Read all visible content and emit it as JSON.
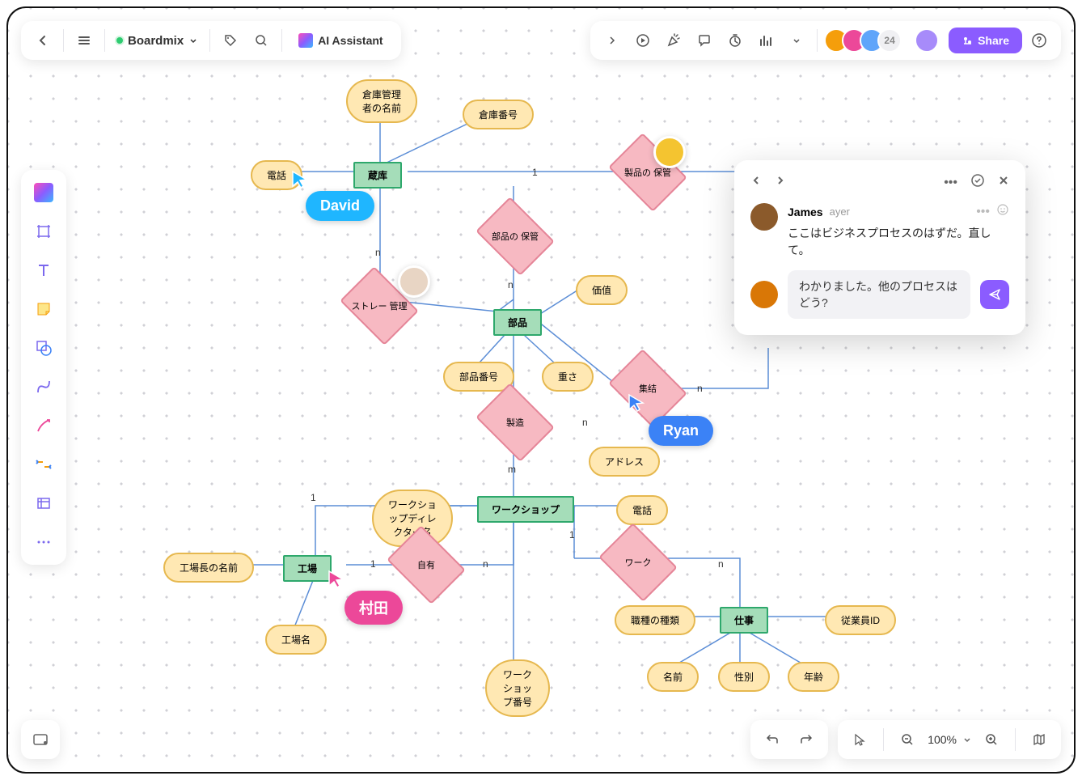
{
  "topbar": {
    "title": "Boardmix",
    "ai_label": "AI Assistant",
    "share_label": "Share",
    "avatar_count": "24"
  },
  "zoom": {
    "value": "100%"
  },
  "cursors": {
    "david": "David",
    "ryan": "Ryan",
    "murata": "村田"
  },
  "comments": {
    "author1": "James",
    "time1": "ayer",
    "text1": "ここはビジネスプロセスのはずだ。直して。",
    "reply_text": "わかりました。他のプロセスはどう?"
  },
  "nodes": {
    "warehouse_mgr_name": "倉庫管理者の名前",
    "warehouse_no": "倉庫番号",
    "phone1": "電話",
    "warehouse": "蔵库",
    "product_storage": "製品の\n保管",
    "parts_storage": "部品の\n保管",
    "storage_mgmt": "ストレー\n管理",
    "value": "価值",
    "parts": "部品",
    "part_no": "部品番号",
    "weight": "重さ",
    "aggregate": "集结",
    "manufacture": "製造",
    "address": "アドレス",
    "workshop_dir": "ワークショップディレクター名",
    "workshop": "ワークショップ",
    "phone2": "電話",
    "factory_mgr_name": "工場長の名前",
    "factory": "工場",
    "own": "自有",
    "work": "ワーク",
    "factory_name": "工場名",
    "workshop_no": "ワークショップ番号",
    "job_type": "職種の種類",
    "job": "仕事",
    "employee_id": "従業員ID",
    "name": "名前",
    "gender": "性別",
    "age": "年齢"
  },
  "edge_labels": {
    "one": "1",
    "n": "n",
    "m": "m"
  }
}
